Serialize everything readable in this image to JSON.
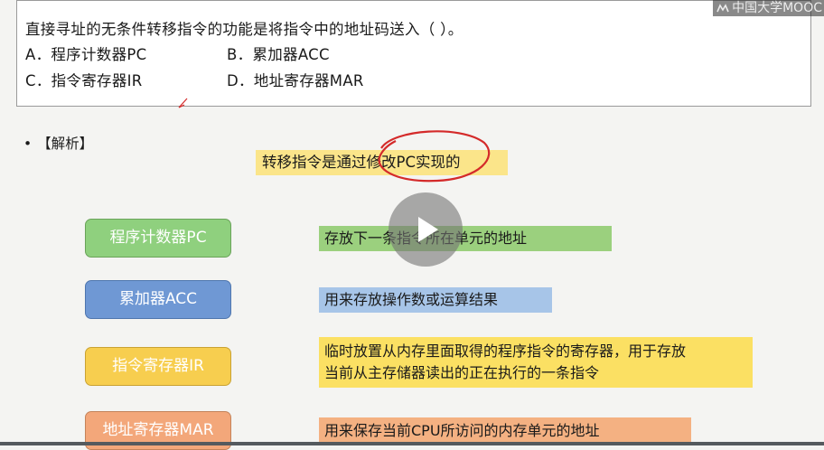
{
  "question": {
    "text": "直接寻址的无条件转移指令的功能是将指令中的地址码送入（    ）。",
    "options": [
      {
        "label": "A．程序计数器PC"
      },
      {
        "label": "B．累加器ACC"
      },
      {
        "label": "C．指令寄存器IR"
      },
      {
        "label": "D．地址寄存器MAR"
      }
    ]
  },
  "watermark": {
    "text": "中国大学MOOC"
  },
  "analysis": {
    "label": "【解析】",
    "highlight": "转移指令是通过修改PC实现的",
    "registers": [
      {
        "name": "程序计数器PC",
        "description": "存放下一条指令所在单元的地址",
        "color": "#8fd07e"
      },
      {
        "name": "累加器ACC",
        "description": "用来存放操作数或运算结果",
        "color": "#6f98d4"
      },
      {
        "name": "指令寄存器IR",
        "description_line1": "临时放置从内存里面取得的程序指令的寄存器，用于存放",
        "description_line2": "当前从主存储器读出的正在执行的一条指令",
        "color": "#f7ce4f"
      },
      {
        "name": "地址寄存器MAR",
        "description": "用来保存当前CPU所访问的内存单元的地址",
        "color": "#f3a77a"
      }
    ]
  },
  "colors": {
    "annotation_circle": "#d42a2a",
    "highlight": "#fbe58a"
  },
  "icons": {
    "play": "play-icon",
    "logo": "mooc-logo-icon"
  }
}
